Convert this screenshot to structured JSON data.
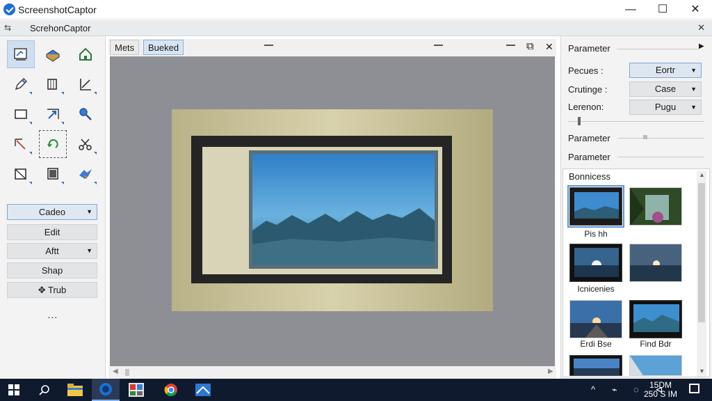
{
  "window": {
    "title": "ScreenshotCaptor",
    "controls": [
      "—",
      "☐",
      "✕"
    ]
  },
  "subbar": {
    "pin": "⇆",
    "label": "ScrehonCaptor",
    "close": "✕"
  },
  "left": {
    "buttons": [
      {
        "label": "Cadeo",
        "dropdown": true
      },
      {
        "label": "Edit",
        "dropdown": false
      },
      {
        "label": "Aftt",
        "dropdown": true
      },
      {
        "label": "Shap",
        "dropdown": false
      },
      {
        "label": "✥ Trub",
        "dropdown": false
      }
    ],
    "more": "..."
  },
  "editor": {
    "tabs": [
      "Mets",
      "Bueked"
    ],
    "window_icons": {
      "restore": "⧉",
      "close": "✕"
    }
  },
  "right": {
    "header": "Parameter",
    "fields": [
      {
        "label": "Pecues :",
        "value": "Eortr"
      },
      {
        "label": "Crutinge :",
        "value": "Case"
      },
      {
        "label": "Lerenon:",
        "value": "Pugu"
      }
    ],
    "param2": "Parameter",
    "param3": "Parameter",
    "browser": {
      "title": "Bonnicess",
      "items": [
        {
          "label": "Pis hh"
        },
        {
          "label": ""
        },
        {
          "label": "Icnicenies"
        },
        {
          "label": ""
        },
        {
          "label": "Erdi Bse"
        },
        {
          "label": "Find Bdr"
        }
      ]
    }
  },
  "taskbar": {
    "clock_time": "15DM",
    "clock_date": "250 S IM",
    "tray": "^ ⌁ ◌ ⊲"
  },
  "colors": {
    "accent": "#5b95d6",
    "taskbar": "#101a2e",
    "canvas": "#8e8f94"
  }
}
